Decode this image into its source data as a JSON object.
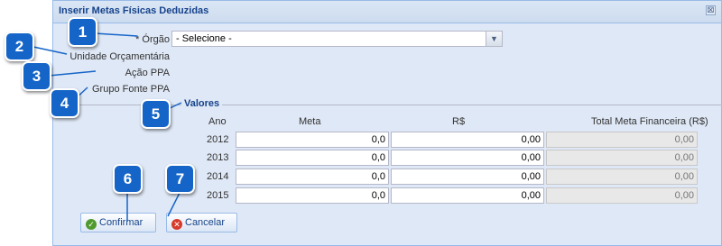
{
  "dialog": {
    "title": "Inserir Metas Físicas Deduzidas",
    "close_glyph": "⊠"
  },
  "form": {
    "orgao_required": "*",
    "orgao_label": "Órgão",
    "orgao_value": "- Selecione -",
    "unidade_label": "Unidade Orçamentária",
    "acao_label": "Ação PPA",
    "grupo_label": "Grupo Fonte PPA"
  },
  "valores": {
    "legend": "Valores",
    "headers": {
      "ano": "Ano",
      "meta": "Meta",
      "rs": "R$",
      "total": "Total Meta Financeira (R$)"
    },
    "rows": [
      {
        "ano": "2012",
        "meta": "0,0",
        "rs": "0,00",
        "total": "0,00"
      },
      {
        "ano": "2013",
        "meta": "0,0",
        "rs": "0,00",
        "total": "0,00"
      },
      {
        "ano": "2014",
        "meta": "0,0",
        "rs": "0,00",
        "total": "0,00"
      },
      {
        "ano": "2015",
        "meta": "0,0",
        "rs": "0,00",
        "total": "0,00"
      }
    ]
  },
  "buttons": {
    "confirm": "Confirmar",
    "cancel": "Cancelar"
  },
  "callouts": [
    "1",
    "2",
    "3",
    "4",
    "5",
    "6",
    "7"
  ],
  "icons": {
    "confirm": "check-circle-icon",
    "cancel": "x-circle-icon",
    "dropdown": "chevron-down-icon"
  },
  "colors": {
    "callout": "#1565c8",
    "panel": "#dfe8f6",
    "title": "#15428b"
  }
}
